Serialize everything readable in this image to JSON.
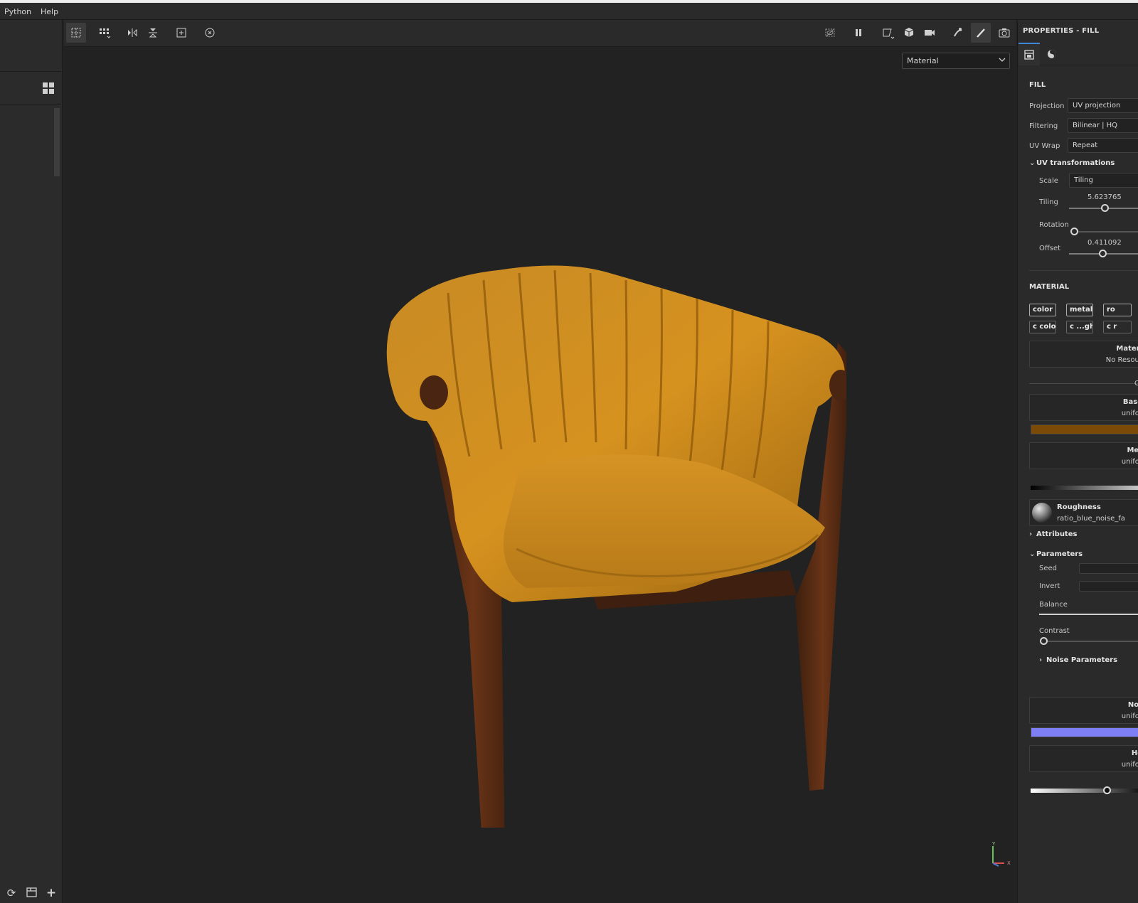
{
  "menu": {
    "items": [
      "Python",
      "Help"
    ]
  },
  "viewport": {
    "mode_select": "Material"
  },
  "properties": {
    "title": "PROPERTIES - FILL",
    "fill": {
      "section": "FILL",
      "projection_label": "Projection",
      "projection_value": "UV projection",
      "filtering_label": "Filtering",
      "filtering_value": "Bilinear | HQ",
      "uvwrap_label": "UV Wrap",
      "uvwrap_value": "Repeat",
      "uvtrans_title": "UV transformations",
      "scale_label": "Scale",
      "scale_value": "Tiling",
      "tiling_label": "Tiling",
      "tiling_value": "5.623765",
      "rotation_label": "Rotation",
      "offset_label": "Offset",
      "offset_value": "0.411092"
    },
    "material": {
      "section": "MATERIAL",
      "channels_row1": [
        "color",
        "metal",
        "ro"
      ],
      "channels_row2": [
        "c color",
        "c ...gh",
        "c r"
      ],
      "material_res_title": "Materi",
      "material_res_sub": "No Resour",
      "small_value": "C",
      "base_title": "Base",
      "base_sub": "unifor",
      "base_color": "#7a4a06",
      "metal_title": "Met",
      "metal_sub": "unifor",
      "roughness_title": "Roughness",
      "roughness_sub": "ratio_blue_noise_fa",
      "attributes_label": "Attributes",
      "parameters_label": "Parameters",
      "seed_label": "Seed",
      "invert_label": "Invert",
      "balance_label": "Balance",
      "contrast_label": "Contrast",
      "noise_params_label": "Noise Parameters",
      "normal_title": "Nor",
      "normal_sub": "unifor",
      "normal_color": "#7f7ff5",
      "height_title": "He",
      "height_sub": "unifor"
    }
  }
}
